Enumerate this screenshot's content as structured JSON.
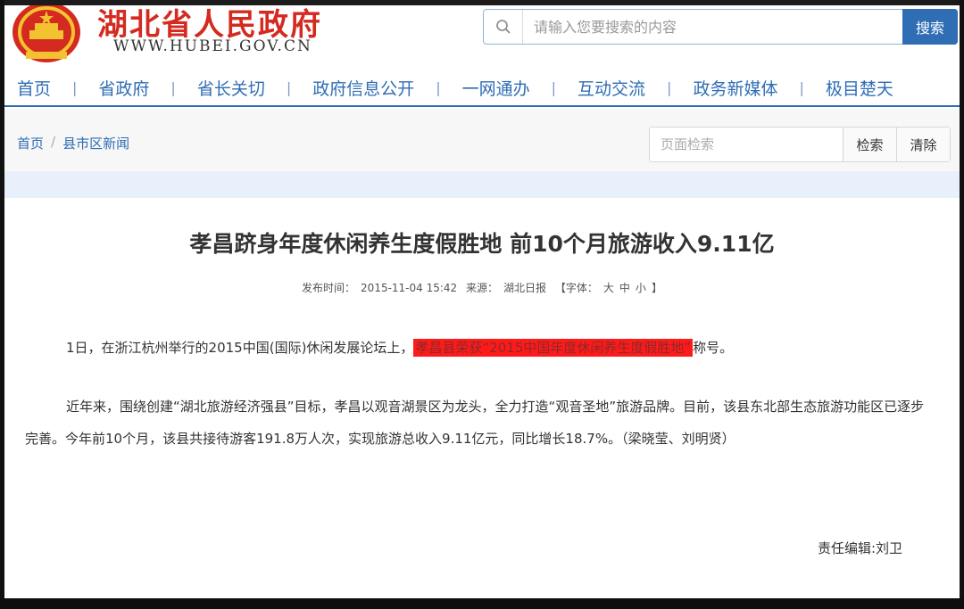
{
  "header": {
    "site_title": "湖北省人民政府",
    "site_url": "WWW.HUBEI.GOV.CN",
    "emblem_icon": "national-emblem-icon",
    "search_placeholder": "请输入您要搜索的内容",
    "search_button": "搜索"
  },
  "nav": {
    "items": [
      "首页",
      "省政府",
      "省长关切",
      "政府信息公开",
      "一网通办",
      "互动交流",
      "政务新媒体",
      "极目楚天"
    ],
    "separator": "|"
  },
  "breadcrumb": {
    "home": "首页",
    "separator": "/",
    "current": "县市区新闻"
  },
  "page_search": {
    "placeholder": "页面检索",
    "search_button": "检索",
    "clear_button": "清除"
  },
  "article": {
    "title": "孝昌跻身年度休闲养生度假胜地 前10个月旅游收入9.11亿",
    "meta": {
      "publish_label": "发布时间：",
      "publish_time": "2015-11-04 15:42",
      "source_label": "来源：",
      "source": "湖北日报",
      "font_label": "【字体：",
      "font_large": "大",
      "font_medium": "中",
      "font_small": "小",
      "font_end": "】"
    },
    "paragraph1": {
      "before": "1日，在浙江杭州举行的2015中国(国际)休闲发展论坛上，",
      "highlight": "孝昌县荣获“2015中国年度休闲养生度假胜地”",
      "after": "称号。"
    },
    "paragraph2": "近年来，围绕创建“湖北旅游经济强县”目标，孝昌以观音湖景区为龙头，全力打造“观音圣地”旅游品牌。目前，该县东北部生态旅游功能区已逐步完善。今年前10个月，该县共接待游客191.8万人次，实现旅游总收入9.11亿元，同比增长18.7%。（梁晓莹、刘明贤）",
    "editor": "责任编辑:刘卫"
  },
  "colors": {
    "brand_red": "#d42a20",
    "nav_blue": "#2f6db5",
    "highlight_red": "#ff1a1a"
  }
}
